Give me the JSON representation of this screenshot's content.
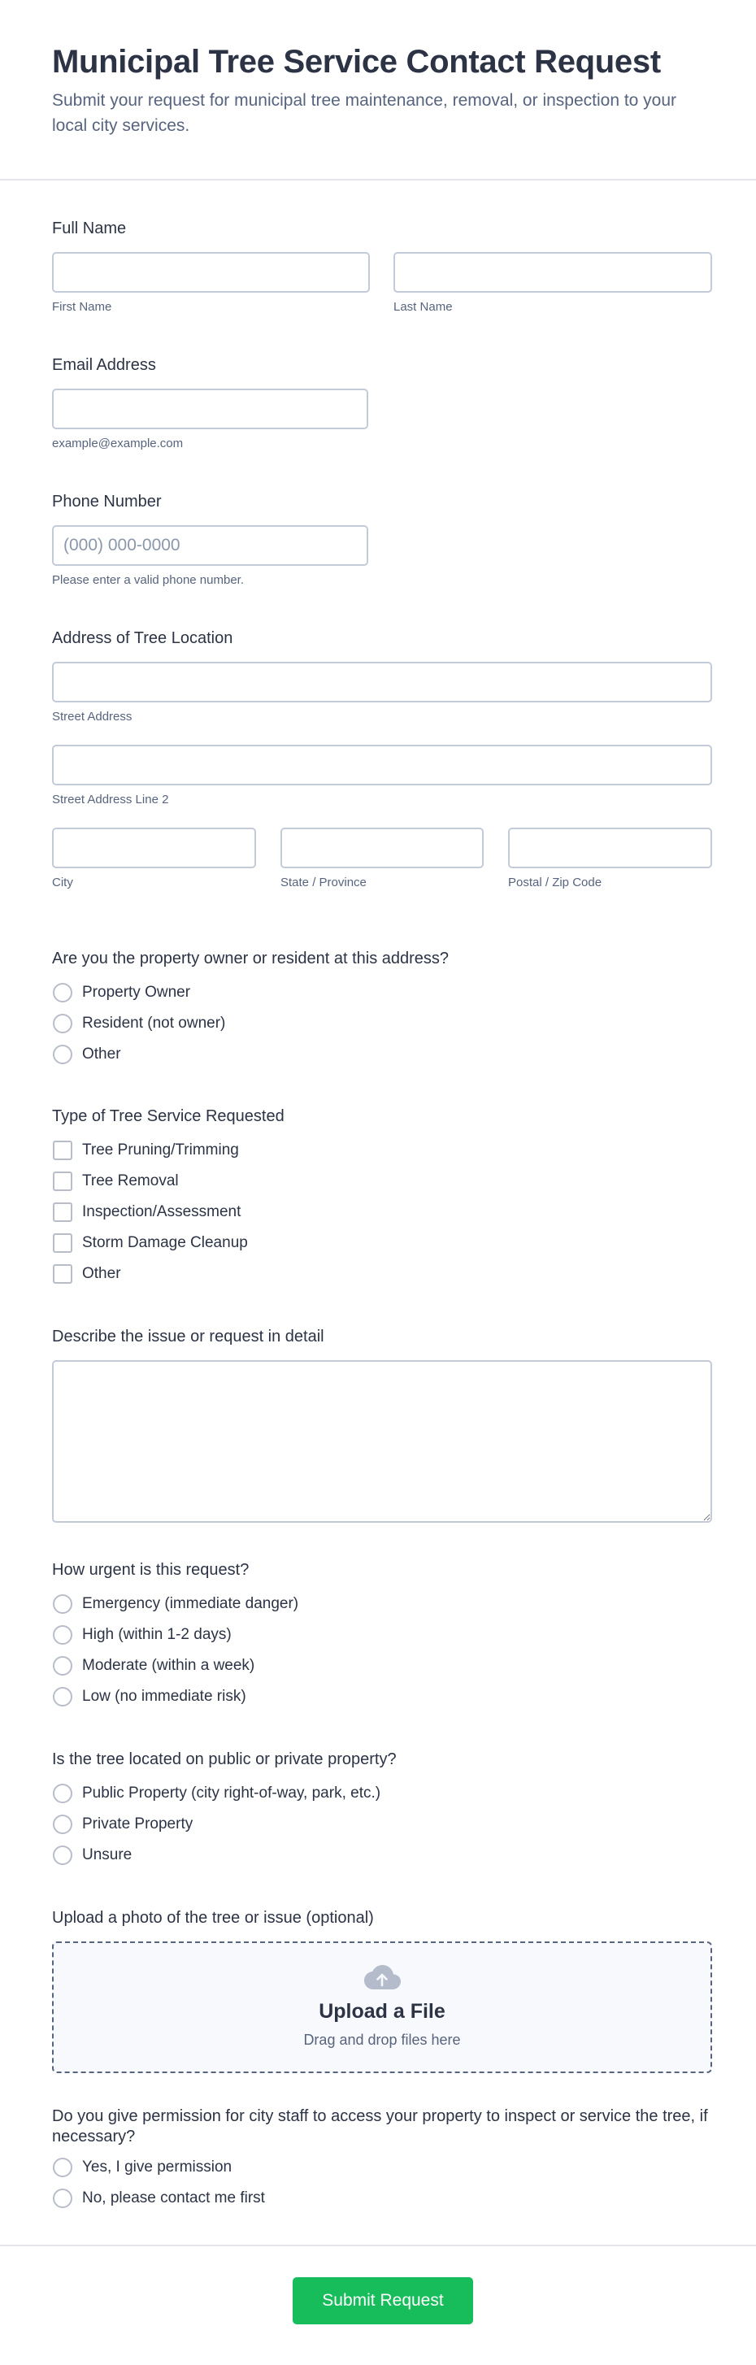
{
  "header": {
    "title": "Municipal Tree Service Contact Request",
    "description": "Submit your request for municipal tree maintenance, removal, or inspection to your local city services."
  },
  "full_name": {
    "label": "Full Name",
    "first_value": "",
    "last_value": "",
    "first_sublabel": "First Name",
    "last_sublabel": "Last Name"
  },
  "email": {
    "label": "Email Address",
    "value": "",
    "sublabel": "example@example.com"
  },
  "phone": {
    "label": "Phone Number",
    "placeholder": "(000) 000-0000",
    "sublabel": "Please enter a valid phone number."
  },
  "address": {
    "label": "Address of Tree Location",
    "street_sublabel": "Street Address",
    "street2_sublabel": "Street Address Line 2",
    "city_sublabel": "City",
    "state_sublabel": "State / Province",
    "zip_sublabel": "Postal / Zip Code"
  },
  "ownership": {
    "label": "Are you the property owner or resident at this address?",
    "options": [
      "Property Owner",
      "Resident (not owner)",
      "Other"
    ]
  },
  "service_type": {
    "label": "Type of Tree Service Requested",
    "options": [
      "Tree Pruning/Trimming",
      "Tree Removal",
      "Inspection/Assessment",
      "Storm Damage Cleanup",
      "Other"
    ]
  },
  "details": {
    "label": "Describe the issue or request in detail",
    "value": ""
  },
  "urgency": {
    "label": "How urgent is this request?",
    "options": [
      "Emergency (immediate danger)",
      "High (within 1-2 days)",
      "Moderate (within a week)",
      "Low (no immediate risk)"
    ]
  },
  "property_type": {
    "label": "Is the tree located on public or private property?",
    "options": [
      "Public Property (city right-of-way, park, etc.)",
      "Private Property",
      "Unsure"
    ]
  },
  "upload": {
    "label": "Upload a photo of the tree or issue (optional)",
    "title": "Upload a File",
    "subtitle": "Drag and drop files here",
    "icon": "cloud-upload-icon"
  },
  "permission": {
    "label": "Do you give permission for city staff to access your property to inspect or service the tree, if necessary?",
    "options": [
      "Yes, I give permission",
      "No, please contact me first"
    ]
  },
  "footer": {
    "submit_label": "Submit Request",
    "submit_color": "#18bd5b"
  }
}
